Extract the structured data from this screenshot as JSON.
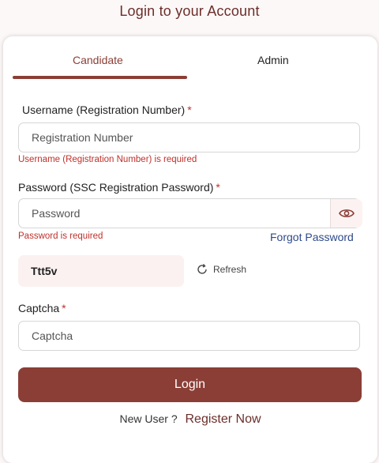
{
  "header": {
    "title": "Login to your Account"
  },
  "tabs": [
    {
      "label": "Candidate",
      "active": true
    },
    {
      "label": "Admin",
      "active": false
    }
  ],
  "username": {
    "label": "Username (Registration Number)",
    "required_mark": "*",
    "placeholder": "Registration Number",
    "value": "",
    "error": "Username (Registration Number) is required"
  },
  "password": {
    "label": "Password (SSC Registration Password)",
    "required_mark": "*",
    "placeholder": "Password",
    "value": "",
    "error": "Password is required",
    "toggle_icon": "eye-icon",
    "forgot_label": "Forgot Password"
  },
  "captcha": {
    "code": "Ttt5v",
    "refresh_label": "Refresh",
    "refresh_icon": "refresh-icon",
    "label": "Captcha",
    "required_mark": "*",
    "placeholder": "Captcha",
    "value": ""
  },
  "login_label": "Login",
  "register": {
    "prompt": "New User ?",
    "link": "Register Now"
  },
  "colors": {
    "brand": "#8b3e36",
    "title": "#6b2e2a",
    "error": "#c0302a",
    "link": "#2e4a8a"
  }
}
